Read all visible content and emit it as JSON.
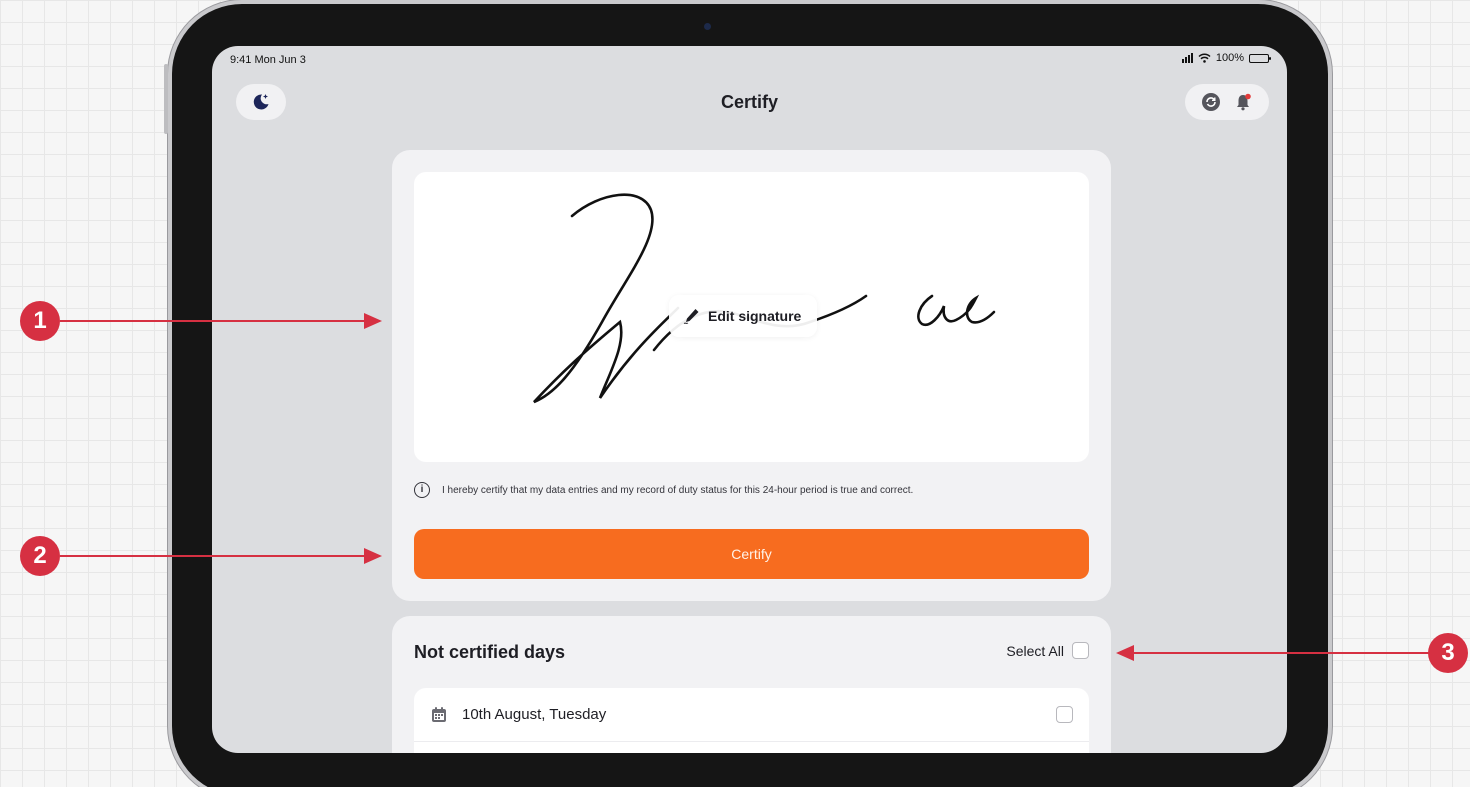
{
  "status_bar": {
    "time": "9:41 Mon Jun 3",
    "battery": "100%"
  },
  "header": {
    "title": "Certify",
    "left_icon": "moon-stars-icon",
    "right_icons": [
      "sync-icon",
      "bell-alert-icon"
    ]
  },
  "signature": {
    "edit_label": "Edit signature",
    "edit_icon": "pen-icon"
  },
  "certification": {
    "statement": "I hereby certify that my data entries and my record of duty status for this 24-hour period is true and correct.",
    "button_label": "Certify"
  },
  "not_certified": {
    "title": "Not certified days",
    "select_all_label": "Select All",
    "days": [
      {
        "label": "10th August, Tuesday",
        "icon": "calendar-icon"
      },
      {
        "label": "",
        "icon": ""
      }
    ]
  },
  "annotations": [
    "1",
    "2",
    "3"
  ],
  "colors": {
    "accent": "#f76c1f",
    "marker": "#d63042",
    "screen_bg": "#dcdde0",
    "card_bg": "#f2f2f4"
  }
}
